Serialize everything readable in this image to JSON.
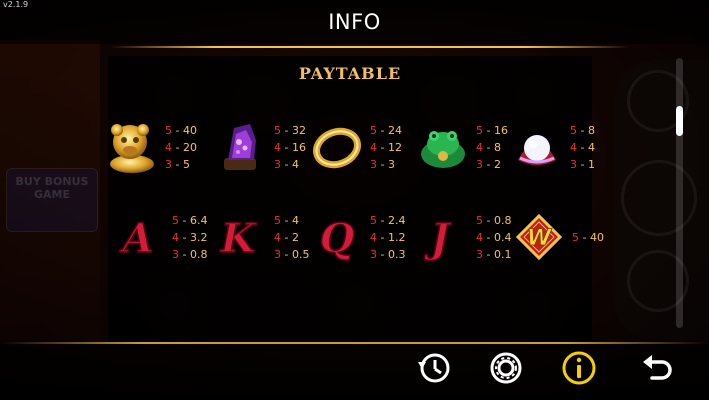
{
  "header": {
    "version": "v2.1.9",
    "title": "INFO"
  },
  "background": {
    "buy_bonus_label": "BUY BONUS GAME"
  },
  "paytable": {
    "title": "PAYTABLE",
    "symbols": [
      {
        "name": "golden-lion",
        "pays": [
          {
            "count": "5",
            "value": "40"
          },
          {
            "count": "4",
            "value": "20"
          },
          {
            "count": "3",
            "value": "5"
          }
        ]
      },
      {
        "name": "amethyst-geode",
        "pays": [
          {
            "count": "5",
            "value": "32"
          },
          {
            "count": "4",
            "value": "16"
          },
          {
            "count": "3",
            "value": "4"
          }
        ]
      },
      {
        "name": "gold-ring",
        "pays": [
          {
            "count": "5",
            "value": "24"
          },
          {
            "count": "4",
            "value": "12"
          },
          {
            "count": "3",
            "value": "3"
          }
        ]
      },
      {
        "name": "jade-toad",
        "pays": [
          {
            "count": "5",
            "value": "16"
          },
          {
            "count": "4",
            "value": "8"
          },
          {
            "count": "3",
            "value": "2"
          }
        ]
      },
      {
        "name": "sacred-pearl",
        "pays": [
          {
            "count": "5",
            "value": "8"
          },
          {
            "count": "4",
            "value": "4"
          },
          {
            "count": "3",
            "value": "1"
          }
        ]
      },
      {
        "name": "letter-a",
        "letter": "A",
        "pays": [
          {
            "count": "5",
            "value": "6.4"
          },
          {
            "count": "4",
            "value": "3.2"
          },
          {
            "count": "3",
            "value": "0.8"
          }
        ]
      },
      {
        "name": "letter-k",
        "letter": "K",
        "pays": [
          {
            "count": "5",
            "value": "4"
          },
          {
            "count": "4",
            "value": "2"
          },
          {
            "count": "3",
            "value": "0.5"
          }
        ]
      },
      {
        "name": "letter-q",
        "letter": "Q",
        "pays": [
          {
            "count": "5",
            "value": "2.4"
          },
          {
            "count": "4",
            "value": "1.2"
          },
          {
            "count": "3",
            "value": "0.3"
          }
        ]
      },
      {
        "name": "letter-j",
        "letter": "J",
        "pays": [
          {
            "count": "5",
            "value": "0.8"
          },
          {
            "count": "4",
            "value": "0.4"
          },
          {
            "count": "3",
            "value": "0.1"
          }
        ]
      },
      {
        "name": "wild",
        "letter": "W",
        "pays": [
          {
            "count": "5",
            "value": "40"
          }
        ]
      }
    ]
  },
  "controls": {
    "icons": [
      "history-icon",
      "settings-icon",
      "info-icon",
      "back-icon"
    ]
  },
  "colors": {
    "accent_gold": "#f2c64d",
    "count_red": "#e8312c",
    "active_icon": "#f5d000"
  },
  "scroll": {
    "position": 0.2
  }
}
